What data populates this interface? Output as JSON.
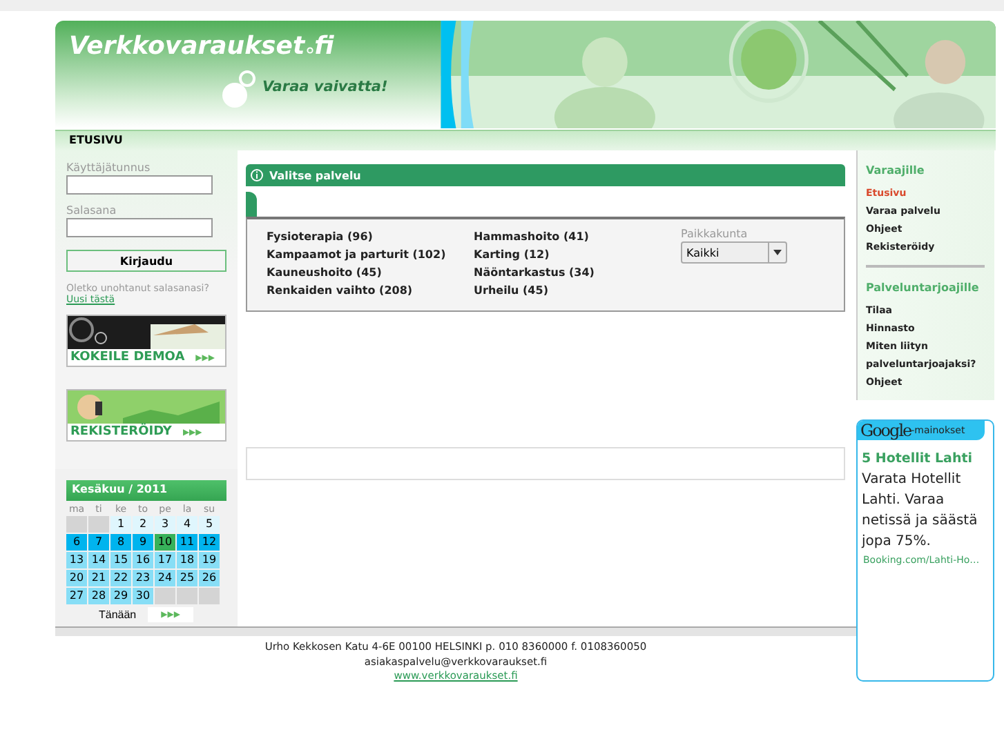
{
  "header": {
    "logo": "Verkkovaraukset",
    "logo_suffix": "fi",
    "slogan": "Varaa vaivatta!"
  },
  "nav": {
    "items": [
      {
        "label": "ETUSIVU",
        "selected": true
      }
    ]
  },
  "login": {
    "username_label": "Käyttäjätunnus",
    "password_label": "Salasana",
    "button": "Kirjaudu",
    "forgot": "Oletko unohtanut salasanasi?",
    "forgot_link": "Uusi tästä"
  },
  "promos": [
    {
      "label": "KOKEILE DEMOA",
      "arrows": "▶▶▶",
      "kind": "demo"
    },
    {
      "label": "REKISTERÖIDY",
      "arrows": "▶▶▶",
      "kind": "register"
    }
  ],
  "calendar": {
    "title": "Kesäkuu / 2011",
    "weekdays": [
      "ma",
      "ti",
      "ke",
      "to",
      "pe",
      "la",
      "su"
    ],
    "days": [
      {
        "kind": "blank"
      },
      {
        "kind": "blank"
      },
      {
        "text": "1",
        "kind": "past"
      },
      {
        "text": "2",
        "kind": "past"
      },
      {
        "text": "3",
        "kind": "past"
      },
      {
        "text": "4",
        "kind": "past"
      },
      {
        "text": "5",
        "kind": "past"
      },
      {
        "text": "6",
        "kind": "week"
      },
      {
        "text": "7",
        "kind": "week"
      },
      {
        "text": "8",
        "kind": "week"
      },
      {
        "text": "9",
        "kind": "week"
      },
      {
        "text": "10",
        "kind": "today"
      },
      {
        "text": "11",
        "kind": "week"
      },
      {
        "text": "12",
        "kind": "week"
      },
      {
        "text": "13",
        "kind": "future"
      },
      {
        "text": "14",
        "kind": "future"
      },
      {
        "text": "15",
        "kind": "future"
      },
      {
        "text": "16",
        "kind": "future"
      },
      {
        "text": "17",
        "kind": "future"
      },
      {
        "text": "18",
        "kind": "future"
      },
      {
        "text": "19",
        "kind": "future"
      },
      {
        "text": "20",
        "kind": "future"
      },
      {
        "text": "21",
        "kind": "future"
      },
      {
        "text": "22",
        "kind": "future"
      },
      {
        "text": "23",
        "kind": "future"
      },
      {
        "text": "24",
        "kind": "future"
      },
      {
        "text": "25",
        "kind": "future"
      },
      {
        "text": "26",
        "kind": "future"
      },
      {
        "text": "27",
        "kind": "future"
      },
      {
        "text": "28",
        "kind": "future"
      },
      {
        "text": "29",
        "kind": "future"
      },
      {
        "text": "30",
        "kind": "future"
      },
      {
        "kind": "blank"
      },
      {
        "kind": "blank"
      },
      {
        "kind": "blank"
      }
    ],
    "today_button": "Tänään",
    "today_arrows": "▶▶▶"
  },
  "services": {
    "title": "Valitse palvelu",
    "columns": [
      [
        "Fysioterapia (96)",
        "Kampaamot ja parturit (102)",
        "Kauneushoito (45)",
        "Renkaiden vaihto (208)"
      ],
      [
        "Hammashoito (41)",
        "Karting (12)",
        "Näöntarkastus (34)",
        "Urheilu (45)"
      ]
    ],
    "city_label": "Paikkakunta",
    "city_value": "Kaikki"
  },
  "sidebar": {
    "sections": [
      {
        "title": "Varaajille",
        "items": [
          {
            "label": "Etusivu",
            "selected": true
          },
          {
            "label": "Varaa palvelu",
            "selected": false
          },
          {
            "label": "Ohjeet",
            "selected": false
          },
          {
            "label": "Rekisteröidy",
            "selected": false
          }
        ]
      },
      {
        "title": "Palveluntarjoajille",
        "items": [
          {
            "label": "Tilaa",
            "selected": false
          },
          {
            "label": "Hinnasto",
            "selected": false
          },
          {
            "label": "Miten liityn palveluntarjoajaksi?",
            "selected": false
          },
          {
            "label": "Ohjeet",
            "selected": false
          }
        ]
      }
    ]
  },
  "ads": {
    "brand": "Google",
    "brand_suffix": "-mainokset",
    "title": "5 Hotellit Lahti",
    "text": "Varata Hotellit Lahti. Varaa netissä ja säästä jopa 75%.",
    "url": "Booking.com/Lahti-Ho…"
  },
  "footer": {
    "address": "Urho Kekkosen Katu 4-6E 00100 HELSINKI p. 010 8360000 f. 0108360050",
    "email": "asiakaspalvelu@verkkovaraukset.fi",
    "link": "www.verkkovaraukset.fi"
  }
}
